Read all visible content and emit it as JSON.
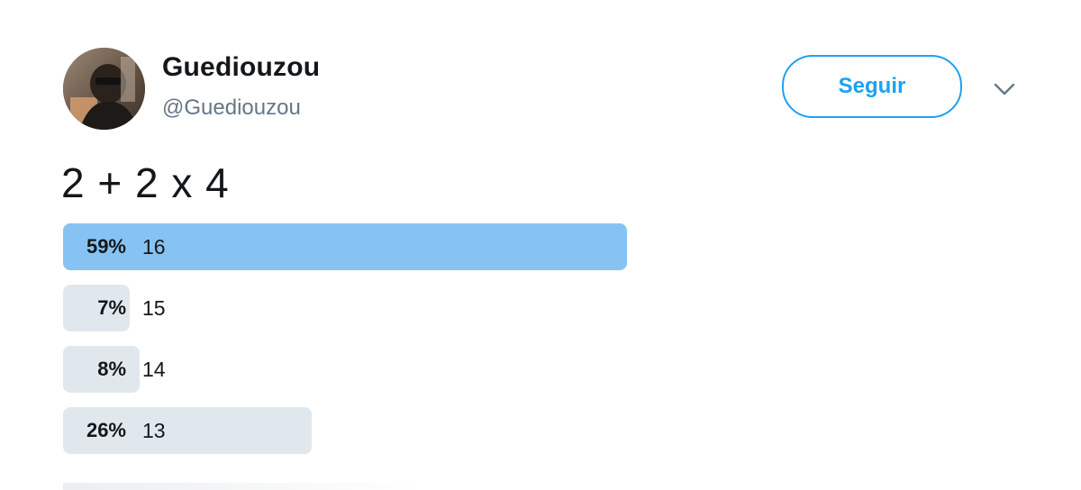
{
  "user": {
    "display_name": "Guediouzou",
    "handle": "@Guediouzou"
  },
  "follow_button": {
    "label": "Seguir"
  },
  "tweet": {
    "text": "2 + 2 x 4"
  },
  "poll": {
    "options": [
      {
        "percent": "59%",
        "value": 59,
        "label": "16",
        "leading": true
      },
      {
        "percent": "7%",
        "value": 7,
        "label": "15",
        "leading": false
      },
      {
        "percent": "8%",
        "value": 8,
        "label": "14",
        "leading": false
      },
      {
        "percent": "26%",
        "value": 26,
        "label": "13",
        "leading": false
      }
    ]
  },
  "colors": {
    "accent": "#1da1f2",
    "leading_bar": "#86c3f3",
    "other_bar": "#e1e8ed",
    "secondary_text": "#657786"
  },
  "icons": {
    "caret": "chevron-down-icon"
  }
}
